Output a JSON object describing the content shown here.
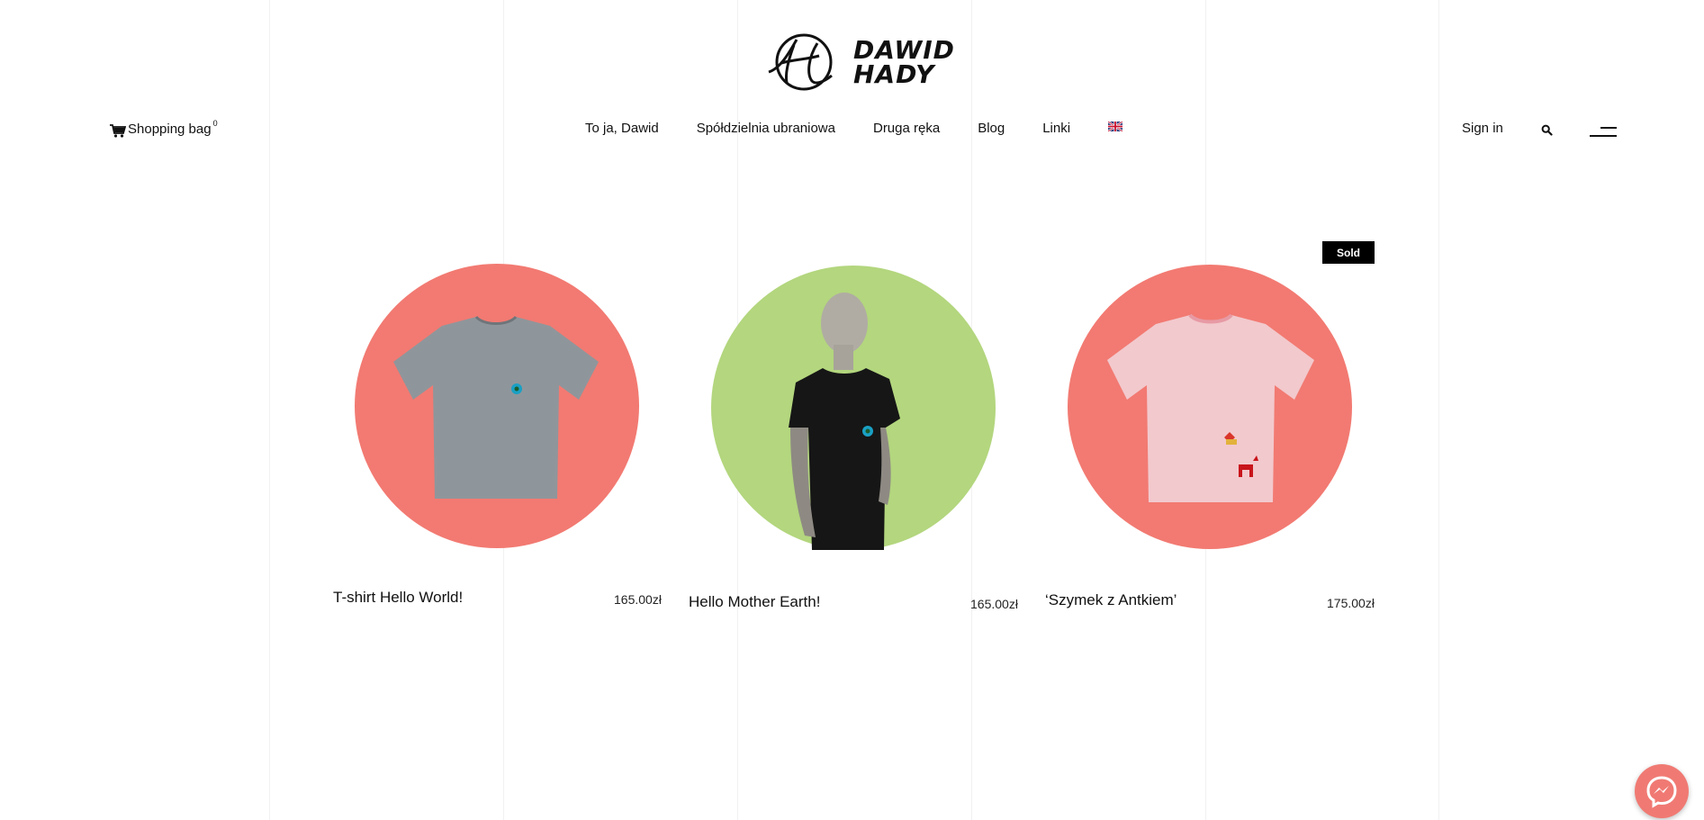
{
  "logo": {
    "line1": "DAWID",
    "line2": "HADY"
  },
  "header": {
    "cart_label": "Shopping bag",
    "cart_count": "0",
    "sign_in": "Sign in"
  },
  "nav": {
    "items": [
      {
        "label": "To ja, Dawid"
      },
      {
        "label": "Spółdzielnia ubraniowa"
      },
      {
        "label": "Druga ręka"
      },
      {
        "label": "Blog"
      },
      {
        "label": "Linki"
      }
    ],
    "language_icon": "uk-flag-icon"
  },
  "products": [
    {
      "name": "T-shirt Hello World!",
      "price": "165.00zł",
      "bg_color": "#f27a72",
      "image": "grey-tshirt"
    },
    {
      "name": "Hello Mother Earth!",
      "price": "165.00zł",
      "bg_color": "#b3d67e",
      "image": "black-tshirt-on-mannequin"
    },
    {
      "name": "‘Szymek z Antkiem’",
      "price": "175.00zł",
      "bg_color": "#f27a72",
      "image": "pink-tshirt",
      "badge": "Sold"
    }
  ],
  "icons": {
    "cart": "cart-icon",
    "search": "search-icon",
    "menu": "menu-icon",
    "chat": "messenger-icon"
  }
}
